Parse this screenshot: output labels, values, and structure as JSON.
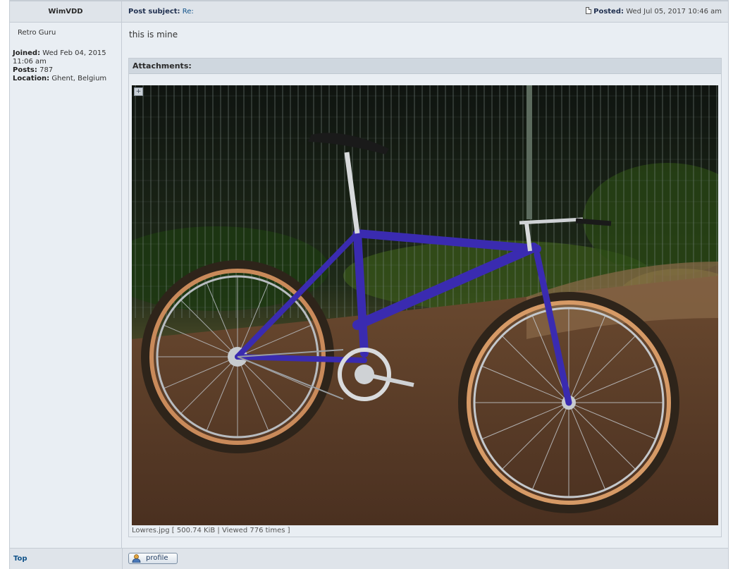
{
  "post": {
    "author": "WimVDD",
    "subject_label": "Post subject:",
    "subject_value": "Re:",
    "posted_label": "Posted:",
    "posted_value": "Wed Jul 05, 2017 10:46 am",
    "message": "this is mine"
  },
  "profile": {
    "rank": "Retro Guru",
    "joined_label": "Joined:",
    "joined_value": "Wed Feb 04, 2015 11:06 am",
    "posts_label": "Posts:",
    "posts_value": "787",
    "location_label": "Location:",
    "location_value": "Ghent, Belgium"
  },
  "attachments": {
    "header": "Attachments:",
    "caption": "Lowres.jpg [ 500.74 KiB | Viewed 776 times ]"
  },
  "footer": {
    "top_link": "Top",
    "profile_button": "profile"
  },
  "colors": {
    "link": "#105289",
    "header_bg": "#dfe4ea",
    "body_bg": "#e9eef3",
    "bike_frame": "#3a2bb0",
    "tire": "#c98a5a"
  }
}
